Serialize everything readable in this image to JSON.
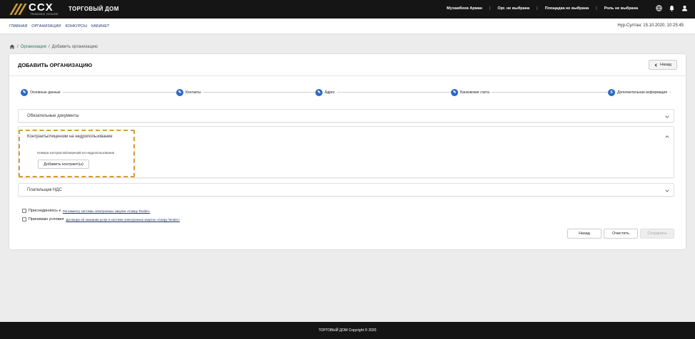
{
  "header": {
    "logo_text": "CCX",
    "logo_sub": "TRADING HOUSE",
    "brand": "ТОРГОВЫЙ ДОМ",
    "user": "Мухамбеев Арман",
    "org": "Орг. не выбрана",
    "platform": "Площадка не выбрана",
    "role": "Роль не выбрана",
    "icons": [
      "globe-icon",
      "bell-icon",
      "user-icon"
    ]
  },
  "nav": {
    "items": [
      "ГЛАВНАЯ",
      "ОРГАНИЗАЦИИ",
      "КОНКУРСЫ",
      "КАБИНЕТ"
    ],
    "datetime": "Нур-Султан: 15.10.2020, 10:25:45"
  },
  "breadcrumb": {
    "items": [
      "Организации",
      "Добавить организацию"
    ],
    "separator": "/"
  },
  "page": {
    "title": "ДОБАВИТЬ ОРГАНИЗАЦИЮ",
    "back_label": "Назад"
  },
  "stepper": {
    "steps": [
      {
        "label": "Основные данные",
        "marker": "✎"
      },
      {
        "label": "Контакты",
        "marker": "✎"
      },
      {
        "label": "Адрес",
        "marker": "✎"
      },
      {
        "label": "Банковские счета",
        "marker": "✎"
      },
      {
        "label": "Дополнительная информация",
        "marker": "5"
      }
    ]
  },
  "panels": {
    "docs": {
      "label": "Обязательные документы"
    },
    "contracts": {
      "label": "Контракты/лицензии на недропользование",
      "field_label": "Номера контрактов/лицензий на недропользование",
      "add_button": "Добавить контракт(ы)"
    },
    "vat": {
      "label": "Плательщик НДС"
    }
  },
  "agreements": [
    {
      "prefix": "Присоединяюсь к",
      "link": "Регламенту системы электронных закупок «Caspy Tender»"
    },
    {
      "prefix": "Принимаю условия",
      "link": "Договора об оказании услуг в системе электронных закупок «Caspy Tender»"
    }
  ],
  "actions": {
    "back": "Назад",
    "clear": "Очистить",
    "save": "Сохранить"
  },
  "footer": {
    "text": "ТОРГОВЫЙ ДОМ Copyright © 2020"
  },
  "colors": {
    "topbar": "#151515",
    "step_active": "#2d69c5",
    "highlight": "#d89a3a",
    "link": "#2a7a5e"
  }
}
